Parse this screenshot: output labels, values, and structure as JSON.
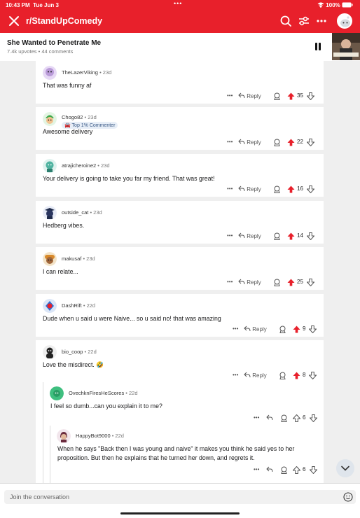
{
  "status": {
    "time": "10:43 PM",
    "date": "Tue Jun 3",
    "battery": "100%"
  },
  "header": {
    "subreddit": "r/StandUpComedy"
  },
  "post": {
    "title": "She Wanted to Penetrate Me",
    "meta": "7.4k upvotes • 44 comments"
  },
  "actions": {
    "reply_label": "Reply",
    "more_label": "•••"
  },
  "comments": [
    {
      "user": "TheLazerViking",
      "age": "• 23d",
      "text": "That was funny af",
      "score": "35"
    },
    {
      "user": "Chogo82",
      "age": "• 23d",
      "badge": "Top 1% Commenter",
      "text": "Awesome delivery",
      "score": "22"
    },
    {
      "user": "atrajicheroine2",
      "age": "• 23d",
      "text": "Your delivery is going to take you far my friend. That was great!",
      "score": "16"
    },
    {
      "user": "outside_cat",
      "age": "• 23d",
      "text": "Hedberg vibes.",
      "score": "14"
    },
    {
      "user": "makusaf",
      "age": "• 23d",
      "text": "I can relate...",
      "score": "25"
    },
    {
      "user": "DashRift",
      "age": "• 22d",
      "text": "Dude when u said u were Naive... so u said no! that was amazing",
      "score": "9"
    },
    {
      "user": "bio_coop",
      "age": "• 22d",
      "text": "Love the misdirect. 🤣",
      "score": "8"
    }
  ],
  "replies": [
    {
      "user": "OvechknFiresHeScores",
      "age": "• 22d",
      "text": "I feel so dumb...can you explain it to me?",
      "score": "6"
    },
    {
      "user": "HappyBot9000",
      "age": "• 22d",
      "text": "When he says \"Back then I was young and naive\" it makes you think he said yes to her proposition. But then he explains that he turned her down, and regrets it.",
      "score": "6"
    }
  ],
  "composer": {
    "placeholder": "Join the conversation"
  },
  "colors": {
    "brand": "#e8202b",
    "upvote": "#e8202b"
  }
}
